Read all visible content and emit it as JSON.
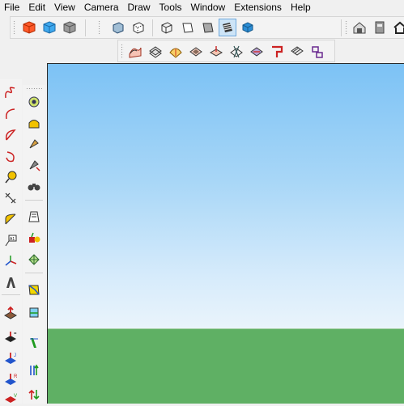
{
  "menu": [
    "File",
    "Edit",
    "View",
    "Camera",
    "Draw",
    "Tools",
    "Window",
    "Extensions",
    "Help"
  ],
  "toolbar_top": {
    "group1": [
      "red-component-icon",
      "blue-component-icon",
      "gray-component-icon"
    ],
    "group2": [
      "xray-style-icon",
      "back-edges-style-icon",
      "wireframe-style-icon",
      "hidden-line-style-icon",
      "shaded-style-icon",
      "shaded-textures-style-icon",
      "monochrome-style-icon"
    ],
    "group3": [
      "warehouse-icon",
      "extension-warehouse-icon",
      "home-view-icon"
    ]
  },
  "toolbar_sandbox": [
    "from-contours-icon",
    "from-scratch-icon",
    "smoove-icon",
    "stamp-icon",
    "drape-icon",
    "add-detail-icon",
    "flip-edge-icon",
    "pipe-icon",
    "terrain-icon",
    "layout-icon"
  ],
  "left_tools": {
    "col1": [
      "freehand-icon",
      "arc-icon",
      "pie-icon",
      "rotated-arc-icon",
      "tape-measure-icon",
      "dimension-icon",
      "protractor-icon",
      "text-icon",
      "axes-icon",
      "3d-text-icon"
    ],
    "col2": [
      "orbit-icon",
      "pan-icon",
      "zoom-icon",
      "zoom-window-icon",
      "walk-icon",
      "section-plane-icon",
      "paint-bucket-icon",
      "position-camera-icon",
      "look-around-icon",
      "section-fill-icon",
      "section-display-icon",
      "section-cuts-icon"
    ],
    "col0_bottom": [
      "push-pull-icon",
      "follow-me-icon",
      "move-up-icon",
      "red-axis-icon",
      "green-axis-icon",
      "offset-icon"
    ]
  },
  "viewport": {
    "sky_color": "#a9d7f7",
    "ground_color": "#5fb064",
    "active_style": "shaded-textures-style-icon"
  }
}
